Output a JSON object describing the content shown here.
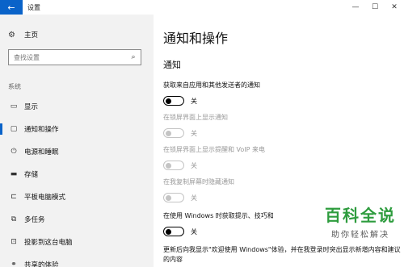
{
  "window": {
    "title": "设置",
    "back_icon": "arrow-left-icon",
    "minimize": "—",
    "maximize": "☐",
    "close": "✕"
  },
  "sidebar": {
    "home_label": "主页",
    "search_placeholder": "查找设置",
    "section_label": "系统",
    "items": [
      {
        "label": "显示",
        "icon": "monitor-icon"
      },
      {
        "label": "通知和操作",
        "icon": "notification-icon",
        "active": true
      },
      {
        "label": "电源和睡眠",
        "icon": "power-icon"
      },
      {
        "label": "存储",
        "icon": "storage-icon"
      },
      {
        "label": "平板电脑模式",
        "icon": "tablet-icon"
      },
      {
        "label": "多任务",
        "icon": "multitask-icon"
      },
      {
        "label": "投影到这台电脑",
        "icon": "project-icon"
      },
      {
        "label": "共享的体验",
        "icon": "share-icon"
      }
    ]
  },
  "main": {
    "title": "通知和操作",
    "sub_heading": "通知",
    "settings": [
      {
        "desc": "获取来自应用和其他发送者的通知",
        "state": "关",
        "disabled": false
      },
      {
        "desc": "在锁屏界面上显示通知",
        "state": "关",
        "disabled": true
      },
      {
        "desc": "在锁屏界面上显示提醒和 VoIP 来电",
        "state": "关",
        "disabled": true
      },
      {
        "desc": "在我复制屏幕时隐藏通知",
        "state": "关",
        "disabled": true
      },
      {
        "desc": "在使用 Windows 时获取提示、技巧和",
        "state": "关",
        "disabled": false
      },
      {
        "desc": "更新后向我显示\"欢迎使用 Windows\"体验，并在我登录时突出显示新增内容和建议的内容",
        "disabled": false
      }
    ]
  },
  "watermark": {
    "title": "百科全说",
    "subtitle": "助你轻松解决"
  }
}
